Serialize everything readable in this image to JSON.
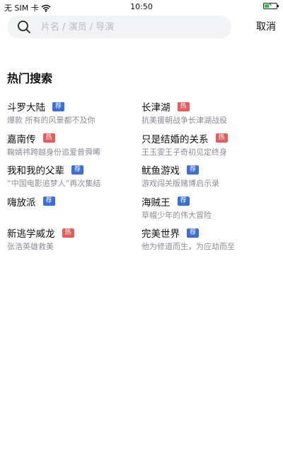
{
  "status_bar": {
    "carrier": "无 SIM 卡",
    "wifi_icon": "wifi-icon",
    "time": "10:50",
    "battery_icon": "battery-charging-icon"
  },
  "search": {
    "placeholder": "片名 / 演员 / 导演",
    "icon": "search-icon",
    "cancel_label": "取消"
  },
  "hot_search": {
    "title": "热门搜索",
    "badge_colors": {
      "热": "#e65b5b",
      "荐": "#3a6fd8"
    },
    "items": [
      {
        "title": "斗罗大陆",
        "badge": "荐",
        "subtitle": "爆款 所有的风景都不及你"
      },
      {
        "title": "长津湖",
        "badge": "热",
        "subtitle": "抗美援朝战争长津湖战役"
      },
      {
        "title": "嘉南传",
        "badge": "热",
        "subtitle": "鞠婧祎跨越身份追爱曾舜晞"
      },
      {
        "title": "只是结婚的关系",
        "badge": "热",
        "subtitle": "王玉雯王子奇初见定终身"
      },
      {
        "title": "我和我的父辈",
        "badge": "荐",
        "subtitle": "“中国电影追梦人”再次集结"
      },
      {
        "title": "鱿鱼游戏",
        "badge": "荐",
        "subtitle": "游戏闯关版赌博启示录"
      },
      {
        "title": "嗨放派",
        "badge": "荐",
        "subtitle": ""
      },
      {
        "title": "海贼王",
        "badge": "荐",
        "subtitle": "草帽少年的伟大冒险"
      },
      {
        "title": "新逃学威龙",
        "badge": "热",
        "subtitle": "张浩英雄救美"
      },
      {
        "title": "完美世界",
        "badge": "荐",
        "subtitle": "他为修道而生，为应劫而至"
      }
    ]
  }
}
